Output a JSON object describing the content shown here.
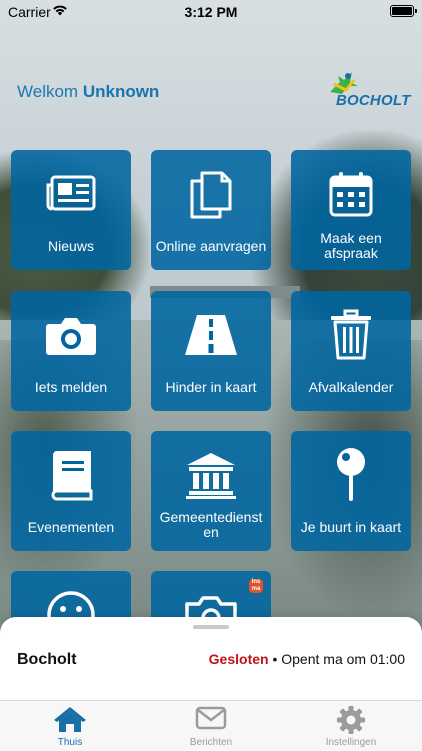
{
  "status_bar": {
    "carrier": "Carrier",
    "time": "3:12 PM"
  },
  "header": {
    "greeting": "Welkom",
    "user": "Unknown",
    "logo_text": "BOCHOLT"
  },
  "tiles": [
    {
      "label": "Nieuws",
      "icon": "newspaper-icon"
    },
    {
      "label": "Online aanvragen",
      "icon": "documents-icon"
    },
    {
      "label": "Maak een afspraak",
      "icon": "calendar-icon"
    },
    {
      "label": "Iets melden",
      "icon": "camera-icon"
    },
    {
      "label": "Hinder in kaart",
      "icon": "road-icon"
    },
    {
      "label": "Afvalkalender",
      "icon": "trash-icon"
    },
    {
      "label": "Evenementen",
      "icon": "book-icon"
    },
    {
      "label": "Gemeentediensten",
      "icon": "government-building-icon"
    },
    {
      "label": "Je buurt in kaart",
      "icon": "map-pin-icon"
    },
    {
      "label": "",
      "icon": "smiley-icon"
    },
    {
      "label": "",
      "icon": "photo-icon",
      "badge": "Ins ma"
    }
  ],
  "sheet": {
    "place": "Bocholt",
    "status_closed": "Gesloten",
    "status_rest": "• Opent ma om 01:00"
  },
  "tabbar": {
    "items": [
      {
        "label": "Thuis",
        "icon": "home-icon",
        "active": true
      },
      {
        "label": "Berichten",
        "icon": "mail-icon",
        "active": false
      },
      {
        "label": "Instellingen",
        "icon": "gear-icon",
        "active": false
      }
    ]
  },
  "colors": {
    "tile": "#0065a0",
    "accent": "#1a6fa8",
    "closed": "#c0141c"
  }
}
